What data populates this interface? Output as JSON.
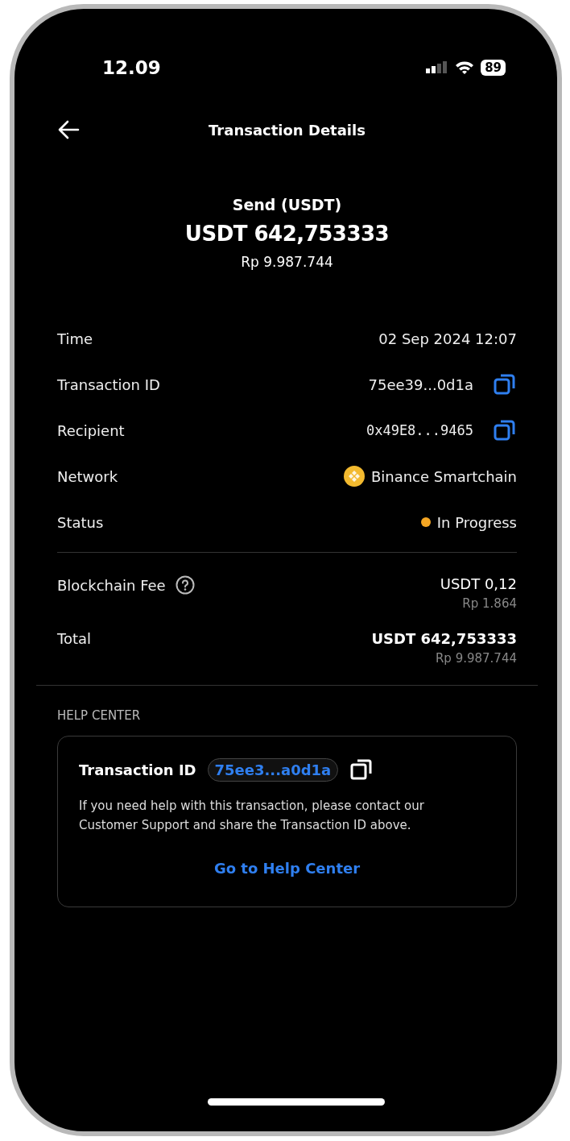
{
  "status_bar": {
    "time": "12.09",
    "battery": "89"
  },
  "header": {
    "title": "Transaction Details"
  },
  "summary": {
    "title": "Send (USDT)",
    "amount": "USDT 642,753333",
    "fiat": "Rp 9.987.744"
  },
  "details": [
    {
      "label": "Time",
      "kind": "text",
      "value": "02 Sep 2024 12:07"
    },
    {
      "label": "Transaction ID",
      "kind": "copy",
      "value": "75ee39...0d1a"
    },
    {
      "label": "Recipient",
      "kind": "address",
      "value": "0x49E8...9465"
    },
    {
      "label": "Network",
      "kind": "network",
      "value": "Binance Smartchain"
    },
    {
      "label": "Status",
      "kind": "status",
      "value": "In Progress",
      "color": "#f5a623"
    }
  ],
  "fees": [
    {
      "label": "Blockchain Fee",
      "help": true,
      "emphasis": false,
      "amount": "USDT 0,12",
      "fiat": "Rp 1.864"
    },
    {
      "label": "Total",
      "help": false,
      "emphasis": true,
      "amount": "USDT 642,753333",
      "fiat": "Rp 9.987.744"
    }
  ],
  "help_center": {
    "heading": "HELP CENTER",
    "id_label": "Transaction ID",
    "id_value": "75ee3...a0d1a",
    "message": "If you need help with this transaction, please contact our Customer Support and share the Transaction ID above.",
    "link": "Go to Help Center"
  }
}
